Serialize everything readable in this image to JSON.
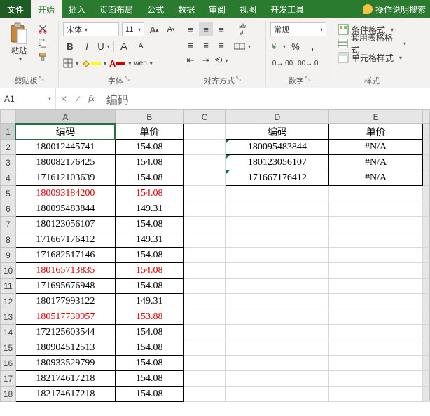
{
  "tabs": {
    "file": "文件",
    "home": "开始",
    "insert": "插入",
    "layout": "页面布局",
    "formulas": "公式",
    "data": "数据",
    "review": "审阅",
    "view": "视图",
    "dev": "开发工具",
    "tell": "操作说明搜索"
  },
  "ribbon": {
    "paste": "粘贴",
    "clipboard": "剪贴板",
    "font_name": "宋体",
    "font_size": "11",
    "font_group": "字体",
    "align_group": "对齐方式",
    "number_format": "常规",
    "number_group": "数字",
    "cond_fmt": "条件格式",
    "table_fmt": "套用表格格式",
    "cell_style": "单元格样式",
    "styles_group": "样式"
  },
  "namebox": "A1",
  "formula": "编码",
  "cols": [
    "A",
    "B",
    "C",
    "D",
    "E"
  ],
  "headers": {
    "a": "编码",
    "b": "单价",
    "d": "编码",
    "e": "单价"
  },
  "rows": [
    {
      "a": "180012445741",
      "b": "154.08",
      "d": "180095483844",
      "e": "#N/A",
      "red": false,
      "derr": true
    },
    {
      "a": "180082176425",
      "b": "154.08",
      "d": "180123056107",
      "e": "#N/A",
      "red": false,
      "derr": true
    },
    {
      "a": "171612103639",
      "b": "154.08",
      "d": "171667176412",
      "e": "#N/A",
      "red": false,
      "derr": true
    },
    {
      "a": "180093184200",
      "b": "154.08",
      "red": true
    },
    {
      "a": "180095483844",
      "b": "149.31",
      "red": false
    },
    {
      "a": "180123056107",
      "b": "154.08",
      "red": false
    },
    {
      "a": "171667176412",
      "b": "149.31",
      "red": false
    },
    {
      "a": "171682517146",
      "b": "154.08",
      "red": false
    },
    {
      "a": "180165713835",
      "b": "154.08",
      "red": true
    },
    {
      "a": "171695676948",
      "b": "154.08",
      "red": false
    },
    {
      "a": "180177993122",
      "b": "149.31",
      "red": false
    },
    {
      "a": "180517730957",
      "b": "153.88",
      "red": true
    },
    {
      "a": "172125603544",
      "b": "154.08",
      "red": false
    },
    {
      "a": "180904512513",
      "b": "154.08",
      "red": false
    },
    {
      "a": "180933529799",
      "b": "154.08",
      "red": false
    },
    {
      "a": "182174617218",
      "b": "154.08",
      "red": false
    },
    {
      "a": "182174617218",
      "b": "154.08",
      "red": false
    }
  ]
}
